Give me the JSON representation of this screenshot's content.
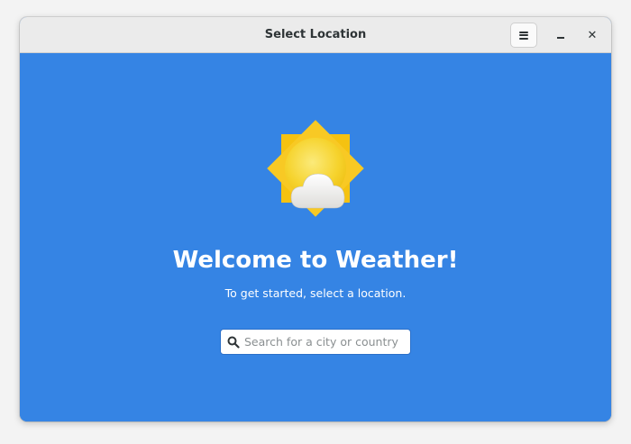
{
  "window": {
    "title": "Select Location",
    "close_symbol": "✕"
  },
  "main": {
    "welcome_title": "Welcome to Weather!",
    "subtitle": "To get started, select a location.",
    "search": {
      "placeholder": "Search for a city or country",
      "value": ""
    }
  },
  "icons": {
    "menu": "hamburger-menu-icon",
    "minimize": "minimize-icon",
    "close": "close-icon",
    "weather": "sun-behind-cloud-icon",
    "search": "magnifier-icon"
  },
  "colors": {
    "accent": "#3584e4",
    "titlebar": "#ebebeb",
    "sun": "#f6d32d",
    "text_on_accent": "#ffffff"
  }
}
